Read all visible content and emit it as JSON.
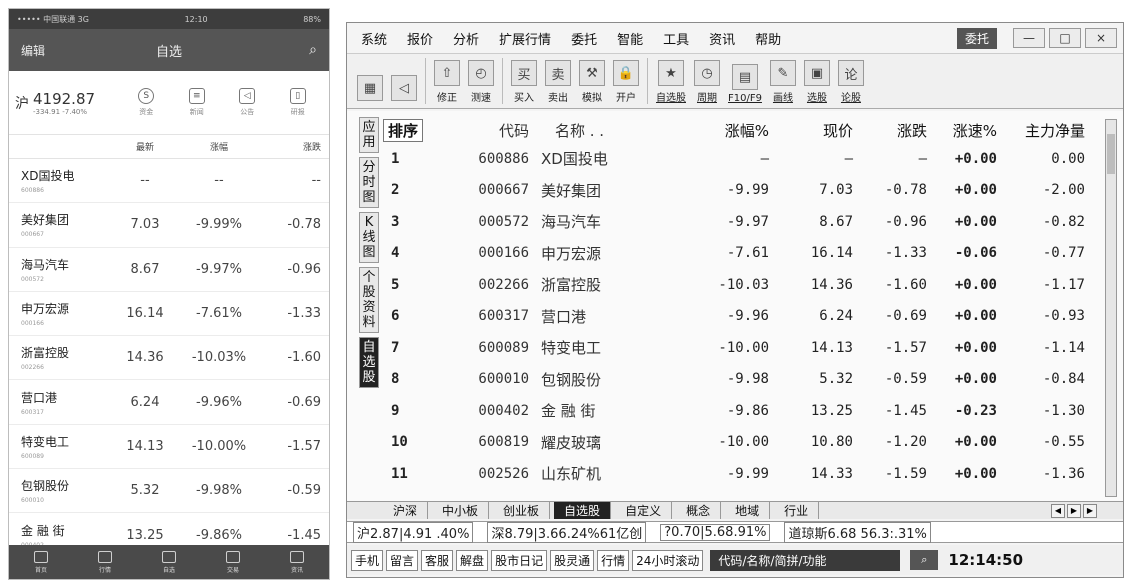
{
  "mobile": {
    "status_left": "••••• 中国联通 3G",
    "status_time": "12:10",
    "status_right": "88%",
    "nav_left": "编辑",
    "nav_title": "自选",
    "index": {
      "market": "沪",
      "value": "4192.87",
      "change": "-334.91 -7.40%"
    },
    "tools": [
      {
        "label": "资金",
        "icon": "S"
      },
      {
        "label": "新闻",
        "icon": "≡"
      },
      {
        "label": "公告",
        "icon": "◁"
      },
      {
        "label": "研报",
        "icon": "▯"
      }
    ],
    "headers": {
      "price": "最新",
      "pct": "涨幅",
      "chg": "涨跌"
    },
    "rows": [
      {
        "name": "XD国投电",
        "code": "600886",
        "price": "--",
        "pct": "--",
        "chg": "--"
      },
      {
        "name": "美好集团",
        "code": "000667",
        "price": "7.03",
        "pct": "-9.99%",
        "chg": "-0.78"
      },
      {
        "name": "海马汽车",
        "code": "000572",
        "price": "8.67",
        "pct": "-9.97%",
        "chg": "-0.96"
      },
      {
        "name": "申万宏源",
        "code": "000166",
        "price": "16.14",
        "pct": "-7.61%",
        "chg": "-1.33"
      },
      {
        "name": "浙富控股",
        "code": "002266",
        "price": "14.36",
        "pct": "-10.03%",
        "chg": "-1.60"
      },
      {
        "name": "营口港",
        "code": "600317",
        "price": "6.24",
        "pct": "-9.96%",
        "chg": "-0.69"
      },
      {
        "name": "特变电工",
        "code": "600089",
        "price": "14.13",
        "pct": "-10.00%",
        "chg": "-1.57"
      },
      {
        "name": "包钢股份",
        "code": "600010",
        "price": "5.32",
        "pct": "-9.98%",
        "chg": "-0.59"
      },
      {
        "name": "金 融 街",
        "code": "000402",
        "price": "13.25",
        "pct": "-9.86%",
        "chg": "-1.45"
      }
    ],
    "tabbar": [
      "首页",
      "行情",
      "自选",
      "交易",
      "资讯"
    ]
  },
  "desktop": {
    "menu": [
      "系统",
      "报价",
      "分析",
      "扩展行情",
      "委托",
      "智能",
      "工具",
      "资讯",
      "帮助"
    ],
    "trade_button": "委托",
    "window_buttons": [
      "—",
      "□",
      "×"
    ],
    "toolbar": [
      {
        "label": "",
        "icon": "▦"
      },
      {
        "label": "",
        "icon": "◁"
      },
      {
        "label": "修正",
        "icon": "⇧"
      },
      {
        "label": "测速",
        "icon": "◴"
      },
      {
        "label": "买入",
        "icon": "买"
      },
      {
        "label": "卖出",
        "icon": "卖"
      },
      {
        "label": "模拟",
        "icon": "⚒"
      },
      {
        "label": "开户",
        "icon": "🔒"
      },
      {
        "label": "自选股",
        "icon": "★"
      },
      {
        "label": "周期",
        "icon": "◷"
      },
      {
        "label": "F10/F9",
        "icon": "▤"
      },
      {
        "label": "画线",
        "icon": "✎"
      },
      {
        "label": "选股",
        "icon": "▣"
      },
      {
        "label": "论股",
        "icon": "论"
      }
    ],
    "side_tabs": [
      "应用",
      "分时图",
      "K线图",
      "个股资料",
      "自选股"
    ],
    "grid_headers": {
      "idx": "排序",
      "code": "代码",
      "name": "名称  .  .",
      "pct": "涨幅%",
      "price": "现价",
      "chg": "涨跌",
      "speed": "涨速%",
      "flow": "主力净量"
    },
    "rows": [
      {
        "idx": "1",
        "code": "600886",
        "name": "XD国投电",
        "pct": "–",
        "price": "–",
        "chg": "–",
        "speed": "+0.00",
        "flow": "0.00"
      },
      {
        "idx": "2",
        "code": "000667",
        "name": "美好集团",
        "pct": "-9.99",
        "price": "7.03",
        "chg": "-0.78",
        "speed": "+0.00",
        "flow": "-2.00"
      },
      {
        "idx": "3",
        "code": "000572",
        "name": "海马汽车",
        "pct": "-9.97",
        "price": "8.67",
        "chg": "-0.96",
        "speed": "+0.00",
        "flow": "-0.82"
      },
      {
        "idx": "4",
        "code": "000166",
        "name": "申万宏源",
        "pct": "-7.61",
        "price": "16.14",
        "chg": "-1.33",
        "speed": "-0.06",
        "flow": "-0.77"
      },
      {
        "idx": "5",
        "code": "002266",
        "name": "浙富控股",
        "pct": "-10.03",
        "price": "14.36",
        "chg": "-1.60",
        "speed": "+0.00",
        "flow": "-1.17"
      },
      {
        "idx": "6",
        "code": "600317",
        "name": "营口港",
        "pct": "-9.96",
        "price": "6.24",
        "chg": "-0.69",
        "speed": "+0.00",
        "flow": "-0.93"
      },
      {
        "idx": "7",
        "code": "600089",
        "name": "特变电工",
        "pct": "-10.00",
        "price": "14.13",
        "chg": "-1.57",
        "speed": "+0.00",
        "flow": "-1.14"
      },
      {
        "idx": "8",
        "code": "600010",
        "name": "包钢股份",
        "pct": "-9.98",
        "price": "5.32",
        "chg": "-0.59",
        "speed": "+0.00",
        "flow": "-0.84"
      },
      {
        "idx": "9",
        "code": "000402",
        "name": "金 融 街",
        "pct": "-9.86",
        "price": "13.25",
        "chg": "-1.45",
        "speed": "-0.23",
        "flow": "-1.30"
      },
      {
        "idx": "10",
        "code": "600819",
        "name": "耀皮玻璃",
        "pct": "-10.00",
        "price": "10.80",
        "chg": "-1.20",
        "speed": "+0.00",
        "flow": "-0.55"
      },
      {
        "idx": "11",
        "code": "002526",
        "name": "山东矿机",
        "pct": "-9.99",
        "price": "14.33",
        "chg": "-1.59",
        "speed": "+0.00",
        "flow": "-1.36"
      }
    ],
    "bottom_tabs": [
      "沪深",
      "中小板",
      "创业板",
      "自选股",
      "自定义",
      "概念",
      "地域",
      "行业"
    ],
    "active_tab": "自选股",
    "indices": [
      "沪2.87|4.91 .40%",
      "深8.79|3.66.24%61亿创",
      "?0.70|5.68.91%",
      "道琼斯6.68 56.3:.31%"
    ],
    "quick_links": [
      "手机",
      "留言",
      "客服",
      "解盘",
      "股市日记",
      "股灵通",
      "行情",
      "24小时滚动"
    ],
    "search_placeholder": "代码/名称/简拼/功能",
    "clock": "12:14:50"
  }
}
